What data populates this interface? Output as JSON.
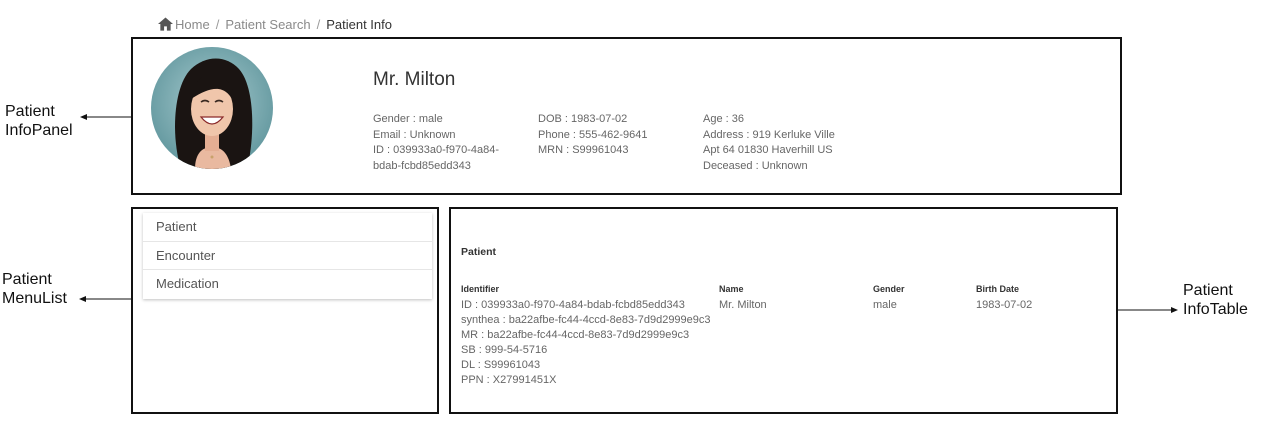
{
  "breadcrumb": {
    "home": "Home",
    "separator": "/",
    "search": "Patient Search",
    "current": "Patient Info",
    "icon": "home-icon"
  },
  "patient": {
    "name": "Mr. Milton",
    "gender": "Gender : male",
    "email": "Email : Unknown",
    "id": "ID : 039933a0-f970-4a84-bdab-fcbd85edd343",
    "dob": "DOB : 1983-07-02",
    "phone": "Phone : 555-462-9641",
    "mrn": "MRN : S99961043",
    "age": "Age : 36",
    "address": "Address : 919 Kerluke Ville Apt 64 01830 Haverhill US",
    "deceased": "Deceased : Unknown"
  },
  "menu": {
    "items": [
      {
        "label": "Patient"
      },
      {
        "label": "Encounter"
      },
      {
        "label": "Medication"
      }
    ]
  },
  "table": {
    "title": "Patient",
    "headers": {
      "identifier": "Identifier",
      "name": "Name",
      "gender": "Gender",
      "birth_date": "Birth Date"
    },
    "row": {
      "identifiers": [
        "ID : 039933a0-f970-4a84-bdab-fcbd85edd343",
        "synthea : ba22afbe-fc44-4ccd-8e83-7d9d2999e9c3",
        "MR : ba22afbe-fc44-4ccd-8e83-7d9d2999e9c3",
        "SB : 999-54-5716",
        "DL : S99961043",
        "PPN : X27991451X"
      ],
      "name": "Mr. Milton",
      "gender": "male",
      "birth_date": "1983-07-02"
    }
  },
  "annotations": {
    "infopanel": [
      "Patient",
      "InfoPanel"
    ],
    "menulist": [
      "Patient",
      "MenuList"
    ],
    "infotable": [
      "Patient",
      "InfoTable"
    ]
  },
  "colors": {
    "box_border": "#111111",
    "avatar_bg": "#6fa4ab",
    "text_muted": "#666666"
  }
}
